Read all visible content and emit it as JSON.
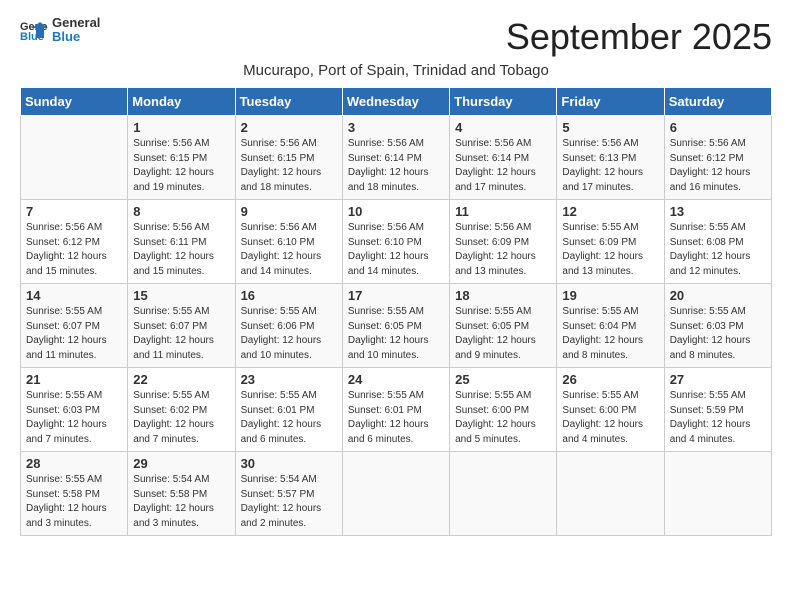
{
  "logo": {
    "line1": "General",
    "line2": "Blue"
  },
  "title": "September 2025",
  "subtitle": "Mucurapo, Port of Spain, Trinidad and Tobago",
  "days_of_week": [
    "Sunday",
    "Monday",
    "Tuesday",
    "Wednesday",
    "Thursday",
    "Friday",
    "Saturday"
  ],
  "weeks": [
    [
      {
        "day": "",
        "info": ""
      },
      {
        "day": "1",
        "info": "Sunrise: 5:56 AM\nSunset: 6:15 PM\nDaylight: 12 hours\nand 19 minutes."
      },
      {
        "day": "2",
        "info": "Sunrise: 5:56 AM\nSunset: 6:15 PM\nDaylight: 12 hours\nand 18 minutes."
      },
      {
        "day": "3",
        "info": "Sunrise: 5:56 AM\nSunset: 6:14 PM\nDaylight: 12 hours\nand 18 minutes."
      },
      {
        "day": "4",
        "info": "Sunrise: 5:56 AM\nSunset: 6:14 PM\nDaylight: 12 hours\nand 17 minutes."
      },
      {
        "day": "5",
        "info": "Sunrise: 5:56 AM\nSunset: 6:13 PM\nDaylight: 12 hours\nand 17 minutes."
      },
      {
        "day": "6",
        "info": "Sunrise: 5:56 AM\nSunset: 6:12 PM\nDaylight: 12 hours\nand 16 minutes."
      }
    ],
    [
      {
        "day": "7",
        "info": "Sunrise: 5:56 AM\nSunset: 6:12 PM\nDaylight: 12 hours\nand 15 minutes."
      },
      {
        "day": "8",
        "info": "Sunrise: 5:56 AM\nSunset: 6:11 PM\nDaylight: 12 hours\nand 15 minutes."
      },
      {
        "day": "9",
        "info": "Sunrise: 5:56 AM\nSunset: 6:10 PM\nDaylight: 12 hours\nand 14 minutes."
      },
      {
        "day": "10",
        "info": "Sunrise: 5:56 AM\nSunset: 6:10 PM\nDaylight: 12 hours\nand 14 minutes."
      },
      {
        "day": "11",
        "info": "Sunrise: 5:56 AM\nSunset: 6:09 PM\nDaylight: 12 hours\nand 13 minutes."
      },
      {
        "day": "12",
        "info": "Sunrise: 5:55 AM\nSunset: 6:09 PM\nDaylight: 12 hours\nand 13 minutes."
      },
      {
        "day": "13",
        "info": "Sunrise: 5:55 AM\nSunset: 6:08 PM\nDaylight: 12 hours\nand 12 minutes."
      }
    ],
    [
      {
        "day": "14",
        "info": "Sunrise: 5:55 AM\nSunset: 6:07 PM\nDaylight: 12 hours\nand 11 minutes."
      },
      {
        "day": "15",
        "info": "Sunrise: 5:55 AM\nSunset: 6:07 PM\nDaylight: 12 hours\nand 11 minutes."
      },
      {
        "day": "16",
        "info": "Sunrise: 5:55 AM\nSunset: 6:06 PM\nDaylight: 12 hours\nand 10 minutes."
      },
      {
        "day": "17",
        "info": "Sunrise: 5:55 AM\nSunset: 6:05 PM\nDaylight: 12 hours\nand 10 minutes."
      },
      {
        "day": "18",
        "info": "Sunrise: 5:55 AM\nSunset: 6:05 PM\nDaylight: 12 hours\nand 9 minutes."
      },
      {
        "day": "19",
        "info": "Sunrise: 5:55 AM\nSunset: 6:04 PM\nDaylight: 12 hours\nand 8 minutes."
      },
      {
        "day": "20",
        "info": "Sunrise: 5:55 AM\nSunset: 6:03 PM\nDaylight: 12 hours\nand 8 minutes."
      }
    ],
    [
      {
        "day": "21",
        "info": "Sunrise: 5:55 AM\nSunset: 6:03 PM\nDaylight: 12 hours\nand 7 minutes."
      },
      {
        "day": "22",
        "info": "Sunrise: 5:55 AM\nSunset: 6:02 PM\nDaylight: 12 hours\nand 7 minutes."
      },
      {
        "day": "23",
        "info": "Sunrise: 5:55 AM\nSunset: 6:01 PM\nDaylight: 12 hours\nand 6 minutes."
      },
      {
        "day": "24",
        "info": "Sunrise: 5:55 AM\nSunset: 6:01 PM\nDaylight: 12 hours\nand 6 minutes."
      },
      {
        "day": "25",
        "info": "Sunrise: 5:55 AM\nSunset: 6:00 PM\nDaylight: 12 hours\nand 5 minutes."
      },
      {
        "day": "26",
        "info": "Sunrise: 5:55 AM\nSunset: 6:00 PM\nDaylight: 12 hours\nand 4 minutes."
      },
      {
        "day": "27",
        "info": "Sunrise: 5:55 AM\nSunset: 5:59 PM\nDaylight: 12 hours\nand 4 minutes."
      }
    ],
    [
      {
        "day": "28",
        "info": "Sunrise: 5:55 AM\nSunset: 5:58 PM\nDaylight: 12 hours\nand 3 minutes."
      },
      {
        "day": "29",
        "info": "Sunrise: 5:54 AM\nSunset: 5:58 PM\nDaylight: 12 hours\nand 3 minutes."
      },
      {
        "day": "30",
        "info": "Sunrise: 5:54 AM\nSunset: 5:57 PM\nDaylight: 12 hours\nand 2 minutes."
      },
      {
        "day": "",
        "info": ""
      },
      {
        "day": "",
        "info": ""
      },
      {
        "day": "",
        "info": ""
      },
      {
        "day": "",
        "info": ""
      }
    ]
  ]
}
